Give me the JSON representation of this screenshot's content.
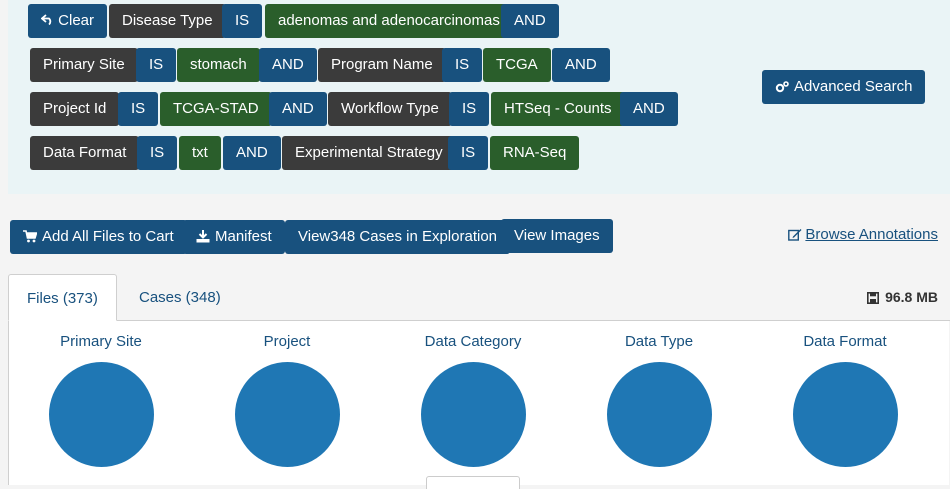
{
  "query": {
    "clear_label": "Clear",
    "rows": [
      [
        {
          "kind": "field",
          "text": "Disease Type"
        },
        {
          "kind": "op",
          "text": "IS"
        },
        {
          "kind": "val",
          "text": "adenomas and adenocarcinomas"
        },
        {
          "kind": "op",
          "text": "AND"
        }
      ],
      [
        {
          "kind": "field",
          "text": "Primary Site"
        },
        {
          "kind": "op",
          "text": "IS"
        },
        {
          "kind": "val",
          "text": "stomach"
        },
        {
          "kind": "op",
          "text": "AND"
        },
        {
          "kind": "field",
          "text": "Program Name"
        },
        {
          "kind": "op",
          "text": "IS"
        },
        {
          "kind": "val",
          "text": "TCGA"
        },
        {
          "kind": "op",
          "text": "AND"
        }
      ],
      [
        {
          "kind": "field",
          "text": "Project Id"
        },
        {
          "kind": "op",
          "text": "IS"
        },
        {
          "kind": "val",
          "text": "TCGA-STAD"
        },
        {
          "kind": "op",
          "text": "AND"
        },
        {
          "kind": "field",
          "text": "Workflow Type"
        },
        {
          "kind": "op",
          "text": "IS"
        },
        {
          "kind": "val",
          "text": "HTSeq - Counts"
        },
        {
          "kind": "op",
          "text": "AND"
        }
      ],
      [
        {
          "kind": "field",
          "text": "Data Format"
        },
        {
          "kind": "op",
          "text": "IS"
        },
        {
          "kind": "val",
          "text": "txt"
        },
        {
          "kind": "op",
          "text": "AND"
        },
        {
          "kind": "field",
          "text": "Experimental Strategy"
        },
        {
          "kind": "op",
          "text": "IS"
        },
        {
          "kind": "val",
          "text": "RNA-Seq"
        }
      ]
    ],
    "advanced_search_label": "Advanced Search"
  },
  "actions": {
    "add_all_label": "Add All Files to Cart",
    "manifest_label": "Manifest",
    "view_cases_label": "View348 Cases in Exploration",
    "view_images_label": "View Images",
    "browse_annotations_label": "Browse Annotations"
  },
  "tabs": {
    "files_label": "Files (373)",
    "cases_label": "Cases (348)",
    "total_size": "96.8 MB"
  },
  "facets": [
    {
      "title": "Primary Site"
    },
    {
      "title": "Project"
    },
    {
      "title": "Data Category"
    },
    {
      "title": "Data Type"
    },
    {
      "title": "Data Format"
    }
  ],
  "colors": {
    "blue": "#18517e",
    "dark": "#3b3b3b",
    "green": "#2a5e2b",
    "pie": "#1f77b4"
  }
}
